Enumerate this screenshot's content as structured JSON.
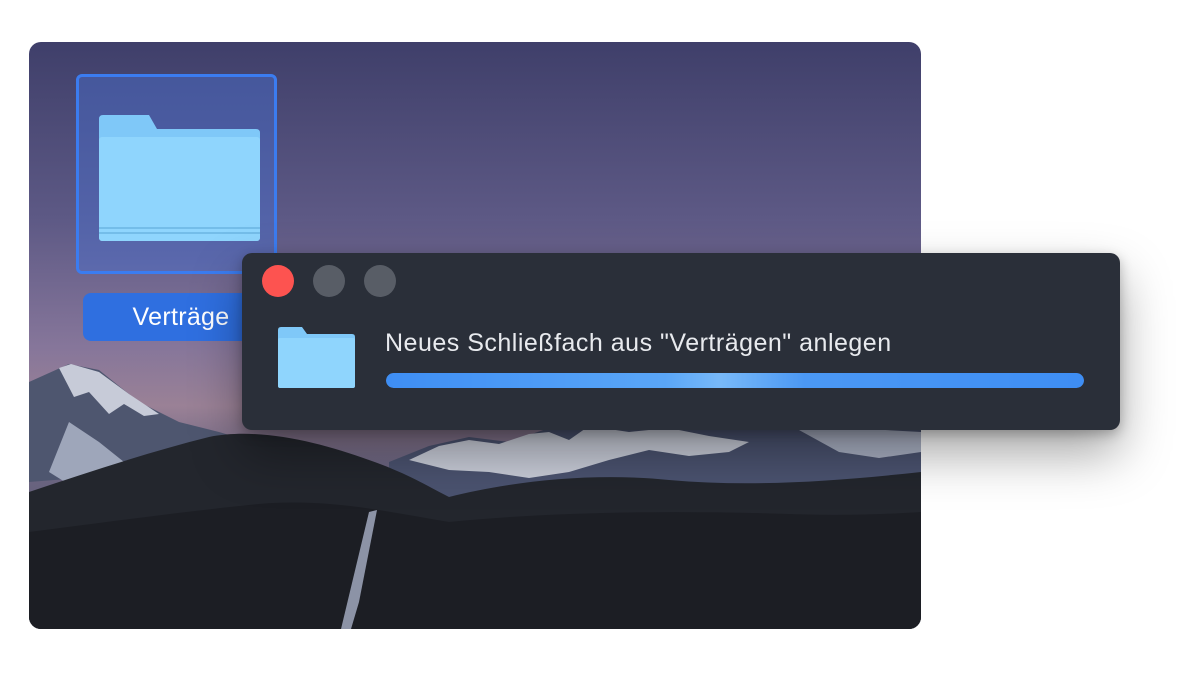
{
  "desktop": {
    "folder": {
      "label": "Verträge",
      "icon": "folder-icon",
      "selected": true,
      "color": "#8fd3fb"
    }
  },
  "dialog": {
    "controls": {
      "close": "close-icon",
      "minimize": "minimize-icon",
      "maximize": "maximize-icon"
    },
    "icon": "folder-icon",
    "title": "Neues Schließfach aus \"Verträgen\" anlegen",
    "progress": 1.0,
    "progress_color": "#3e8ef4"
  },
  "colors": {
    "selection": "#2f6fe0",
    "dialog_bg": "#2a2f39",
    "close_button": "#fd5350"
  }
}
